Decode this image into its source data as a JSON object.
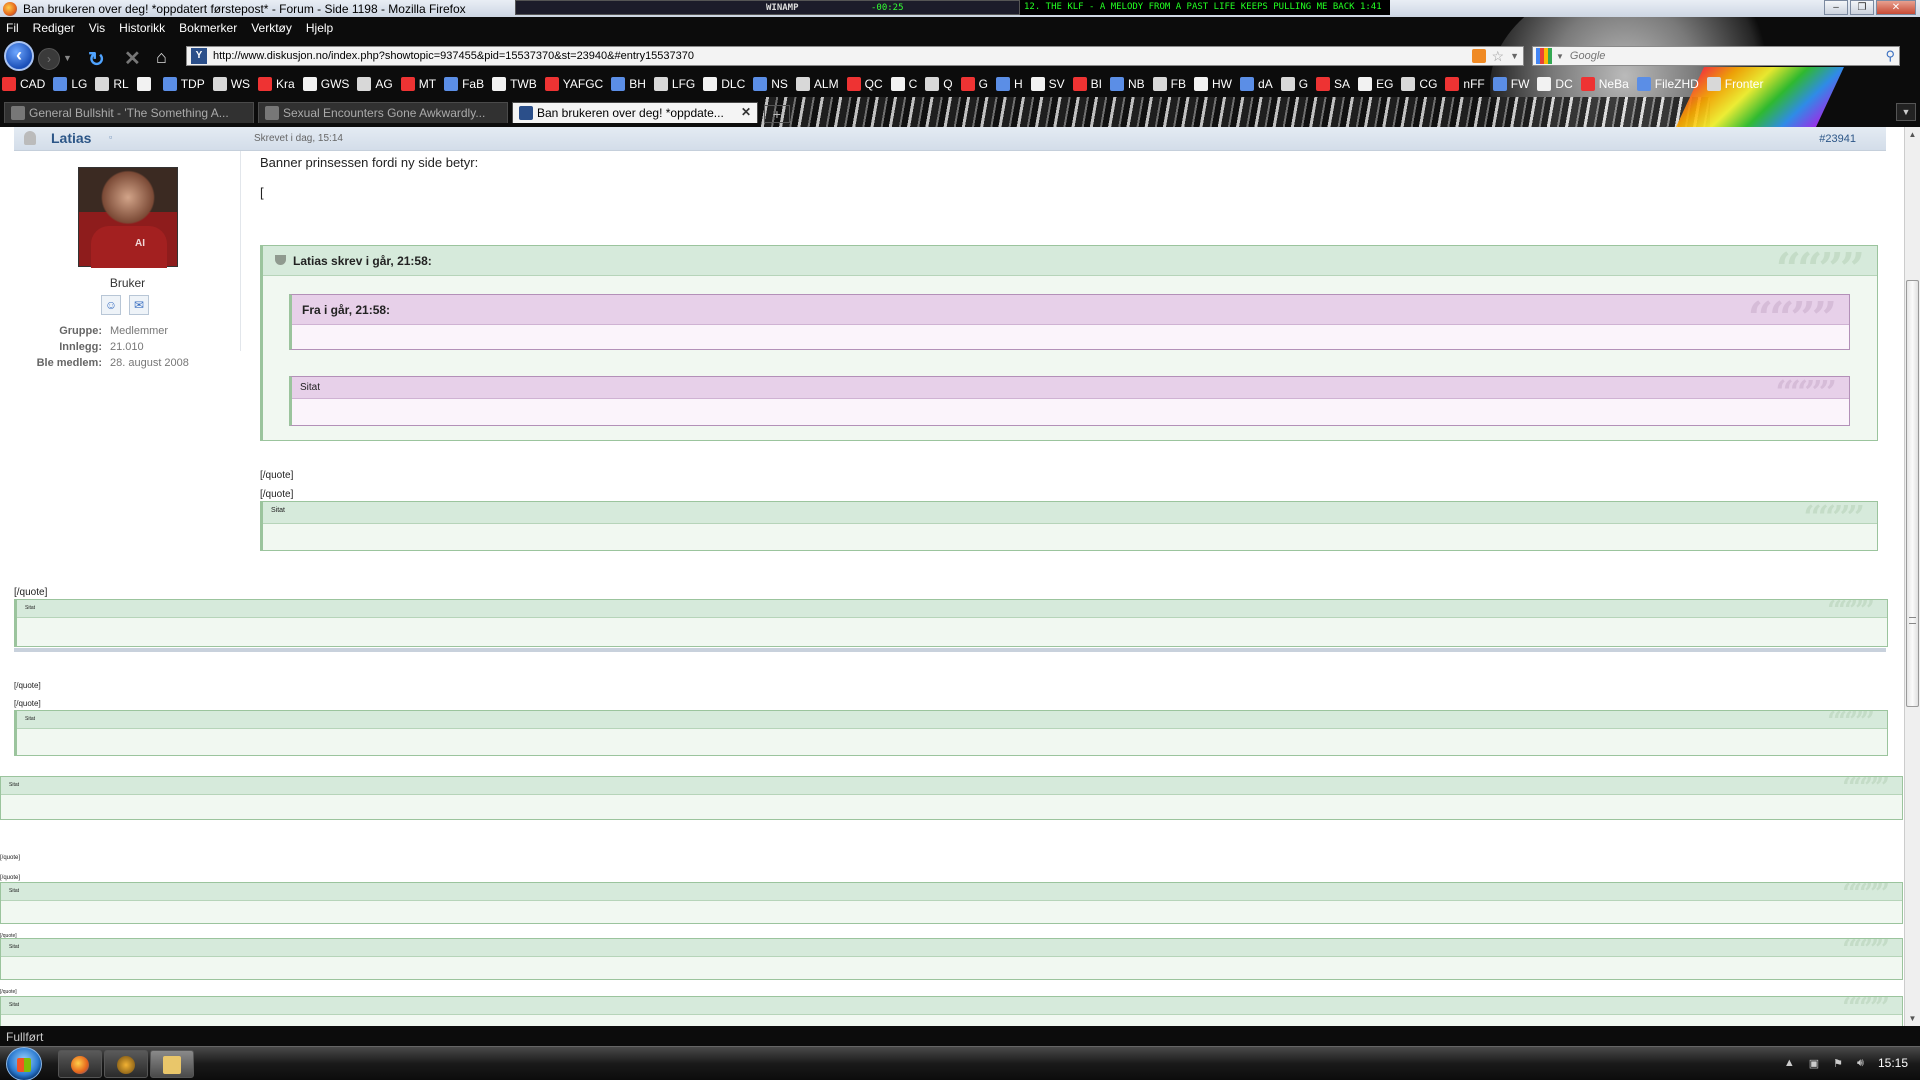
{
  "window": {
    "title": "Ban brukeren over deg! *oppdatert førstepost* - Forum - Side 1198 - Mozilla Firefox",
    "controls": [
      "–",
      "❐",
      "✕"
    ]
  },
  "winamp": {
    "label": "WINAMP",
    "time": "-00:25",
    "marquee": "12. THE KLF - A MELODY FROM A PAST LIFE KEEPS PULLING ME BACK  1:41"
  },
  "menu": [
    "Fil",
    "Rediger",
    "Vis",
    "Historikk",
    "Bokmerker",
    "Verktøy",
    "Hjelp"
  ],
  "nav": {
    "url": "http://www.diskusjon.no/index.php?showtopic=937455&pid=15537370&st=23940&#entry15537370",
    "search_placeholder": "Google"
  },
  "bookmarks": [
    "CAD",
    "LG",
    "RL",
    "",
    "TDP",
    "WS",
    "Kra",
    "GWS",
    "AG",
    "MT",
    "FaB",
    "TWB",
    "YAFGC",
    "BH",
    "LFG",
    "DLC",
    "NS",
    "ALM",
    "QC",
    "C",
    "Q",
    "G",
    "H",
    "SV",
    "BI",
    "NB",
    "FB",
    "HW",
    "dA",
    "G",
    "SA",
    "EG",
    "CG",
    "nFF",
    "FW",
    "DC",
    "NeBa",
    "FileZHD",
    "Fronter"
  ],
  "tabs": [
    {
      "label": "General Bullshit - 'The Something A...",
      "active": false
    },
    {
      "label": "Sexual Encounters Gone Awkwardly...",
      "active": false
    },
    {
      "label": "Ban brukeren over deg! *oppdate...",
      "active": true
    }
  ],
  "post": {
    "author": "Latias",
    "post_id": "#23941",
    "rank": "Bruker",
    "meta": [
      {
        "key": "Gruppe:",
        "value": "Medlemmer"
      },
      {
        "key": "Innlegg:",
        "value": "21.010"
      },
      {
        "key": "Ble medlem:",
        "value": "28. august 2008"
      }
    ],
    "written": "Skrevet i dag, 15:14",
    "text": "Banner prinsessen fordi ny side betyr:",
    "bracket": "["
  },
  "quotes": {
    "q1_title": "Latias skrev i går, 21:58:",
    "q2_title": "Fra i går, 21:58:",
    "q3_title": "Sitat",
    "sitat": "Sitat",
    "close_tag": "[/quote]",
    "quote_marks": "““””"
  },
  "status": "Fullført",
  "taskbar": {
    "clock": "15:15"
  }
}
